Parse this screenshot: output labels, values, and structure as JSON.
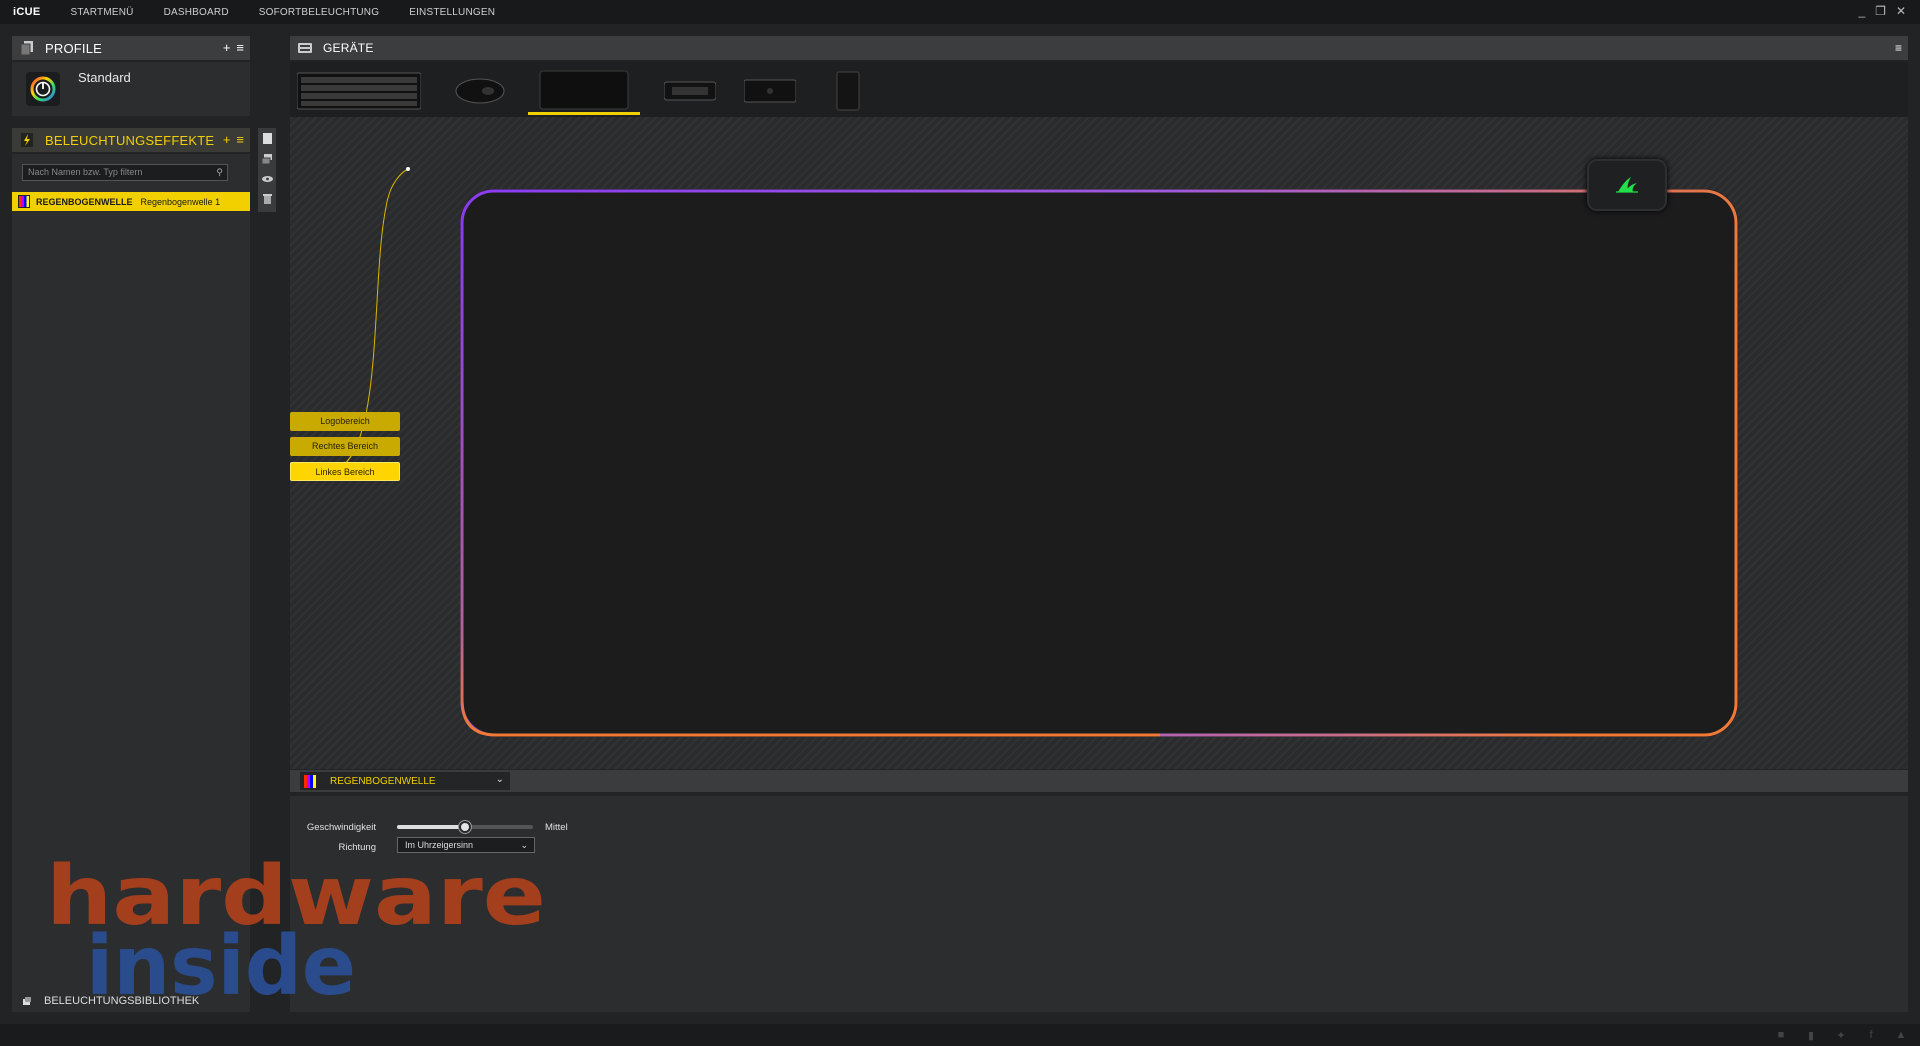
{
  "app": {
    "brand": "iCUE",
    "nav": [
      "STARTMENÜ",
      "DASHBOARD",
      "SOFORTBELEUCHTUNG",
      "EINSTELLUNGEN"
    ],
    "window_controls": [
      "_",
      "❐",
      "✕"
    ]
  },
  "profile": {
    "title": "PROFILE",
    "add": "+",
    "menu": "≡",
    "name": "Standard"
  },
  "effects": {
    "title": "BELEUCHTUNGSEFFEKTE",
    "add": "+",
    "menu": "≡",
    "search_placeholder": "Nach Namen bzw. Typ filtern",
    "items": [
      {
        "type": "REGENBOGENWELLE",
        "name": "Regenbogenwelle 1"
      }
    ]
  },
  "library": {
    "label": "BELEUCHTUNGSBIBLIOTHEK"
  },
  "devices": {
    "title": "GERÄTE",
    "items": [
      "keyboard",
      "mouse",
      "mousepad",
      "controller",
      "hub",
      "psu"
    ],
    "active": "mousepad"
  },
  "zones": [
    "Logobereich",
    "Rechtes Bereich",
    "Linkes Bereich"
  ],
  "editor": {
    "effect": "REGENBOGENWELLE",
    "speed_label": "Geschwindigkeit",
    "speed_value": "Mittel",
    "speed_level": 0.5,
    "direction_label": "Richtung",
    "direction_value": "Im Uhrzeigersinn"
  },
  "watermark": {
    "line1": "hardware",
    "line2": "inside"
  },
  "colors": {
    "accent": "#f2d000",
    "mat_purple": "#8b3cf0",
    "mat_orange": "#f07a35",
    "corsair_green": "#22e04a"
  }
}
